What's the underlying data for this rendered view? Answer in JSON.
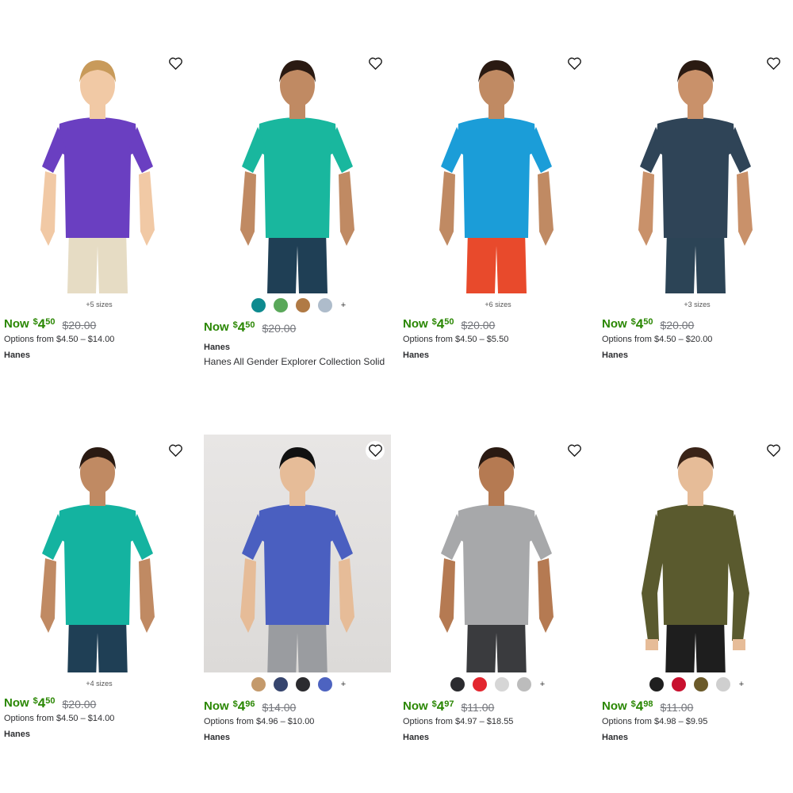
{
  "products": [
    {
      "sizes_note": "+5 sizes",
      "now_label": "Now",
      "currency": "$",
      "dollars": "4",
      "cents": "50",
      "was": "$20.00",
      "options": "Options from $4.50 – $14.00",
      "brand": "Hanes",
      "title": "",
      "swatches": [],
      "shirt_color": "#6a3fc1",
      "pants_color": "#e6dcc4",
      "skin": "#f1c9a5",
      "hair": "#c89a5a"
    },
    {
      "sizes_note": "",
      "now_label": "Now",
      "currency": "$",
      "dollars": "4",
      "cents": "50",
      "was": "$20.00",
      "options": "",
      "brand": "Hanes",
      "title": "Hanes All Gender Explorer Collection Solid",
      "swatches": [
        "#0e8a8f",
        "#5aa85a",
        "#b07a45",
        "#aebccb"
      ],
      "more": "+",
      "shirt_color": "#19b79e",
      "pants_color": "#1f3f55",
      "skin": "#c08a63",
      "hair": "#2a1a12"
    },
    {
      "sizes_note": "+6 sizes",
      "now_label": "Now",
      "currency": "$",
      "dollars": "4",
      "cents": "50",
      "was": "$20.00",
      "options": "Options from $4.50 – $5.50",
      "brand": "Hanes",
      "title": "",
      "swatches": [],
      "shirt_color": "#1b9dd8",
      "pants_color": "#e84a2c",
      "skin": "#c08a63",
      "hair": "#2a1a12"
    },
    {
      "sizes_note": "+3 sizes",
      "now_label": "Now",
      "currency": "$",
      "dollars": "4",
      "cents": "50",
      "was": "$20.00",
      "options": "Options from $4.50 – $20.00",
      "brand": "Hanes",
      "title": "",
      "swatches": [],
      "shirt_color": "#2f4457",
      "pants_color": "#2c4456",
      "skin": "#c9916a",
      "hair": "#2a1a12"
    },
    {
      "sizes_note": "+4 sizes",
      "now_label": "Now",
      "currency": "$",
      "dollars": "4",
      "cents": "50",
      "was": "$20.00",
      "options": "Options from $4.50 – $14.00",
      "brand": "Hanes",
      "title": "",
      "swatches": [],
      "shirt_color": "#14b3a0",
      "pants_color": "#1f3f55",
      "skin": "#c08a63",
      "hair": "#2a1a12"
    },
    {
      "sizes_note": "",
      "now_label": "Now",
      "currency": "$",
      "dollars": "4",
      "cents": "96",
      "was": "$14.00",
      "options": "Options from $4.96 – $10.00",
      "brand": "Hanes",
      "title": "",
      "swatches": [
        "#c49a6c",
        "#36456e",
        "#2b2b2f",
        "#4d63c0"
      ],
      "more": "+",
      "shirt_color": "#4a5fc0",
      "pants_color": "#9a9ca0",
      "skin": "#e6bc98",
      "hair": "#111111"
    },
    {
      "sizes_note": "",
      "now_label": "Now",
      "currency": "$",
      "dollars": "4",
      "cents": "97",
      "was": "$11.00",
      "options": "Options from $4.97 – $18.55",
      "brand": "Hanes",
      "title": "",
      "swatches": [
        "#2b2b2f",
        "#e3262f",
        "#d6d6d6",
        "#bcbcbc"
      ],
      "more": "+",
      "shirt_color": "#a7a8aa",
      "pants_color": "#3a3b3e",
      "skin": "#b57a52",
      "hair": "#2a1a12"
    },
    {
      "sizes_note": "",
      "now_label": "Now",
      "currency": "$",
      "dollars": "4",
      "cents": "98",
      "was": "$11.00",
      "options": "Options from $4.98 – $9.95",
      "brand": "Hanes",
      "title": "",
      "swatches": [
        "#1f1f1f",
        "#c8102e",
        "#6b5a2a",
        "#cfcfcf"
      ],
      "more": "+",
      "shirt_color": "#5a5a2e",
      "pants_color": "#1e1e1e",
      "skin": "#e6bc98",
      "hair": "#3a2418"
    }
  ]
}
